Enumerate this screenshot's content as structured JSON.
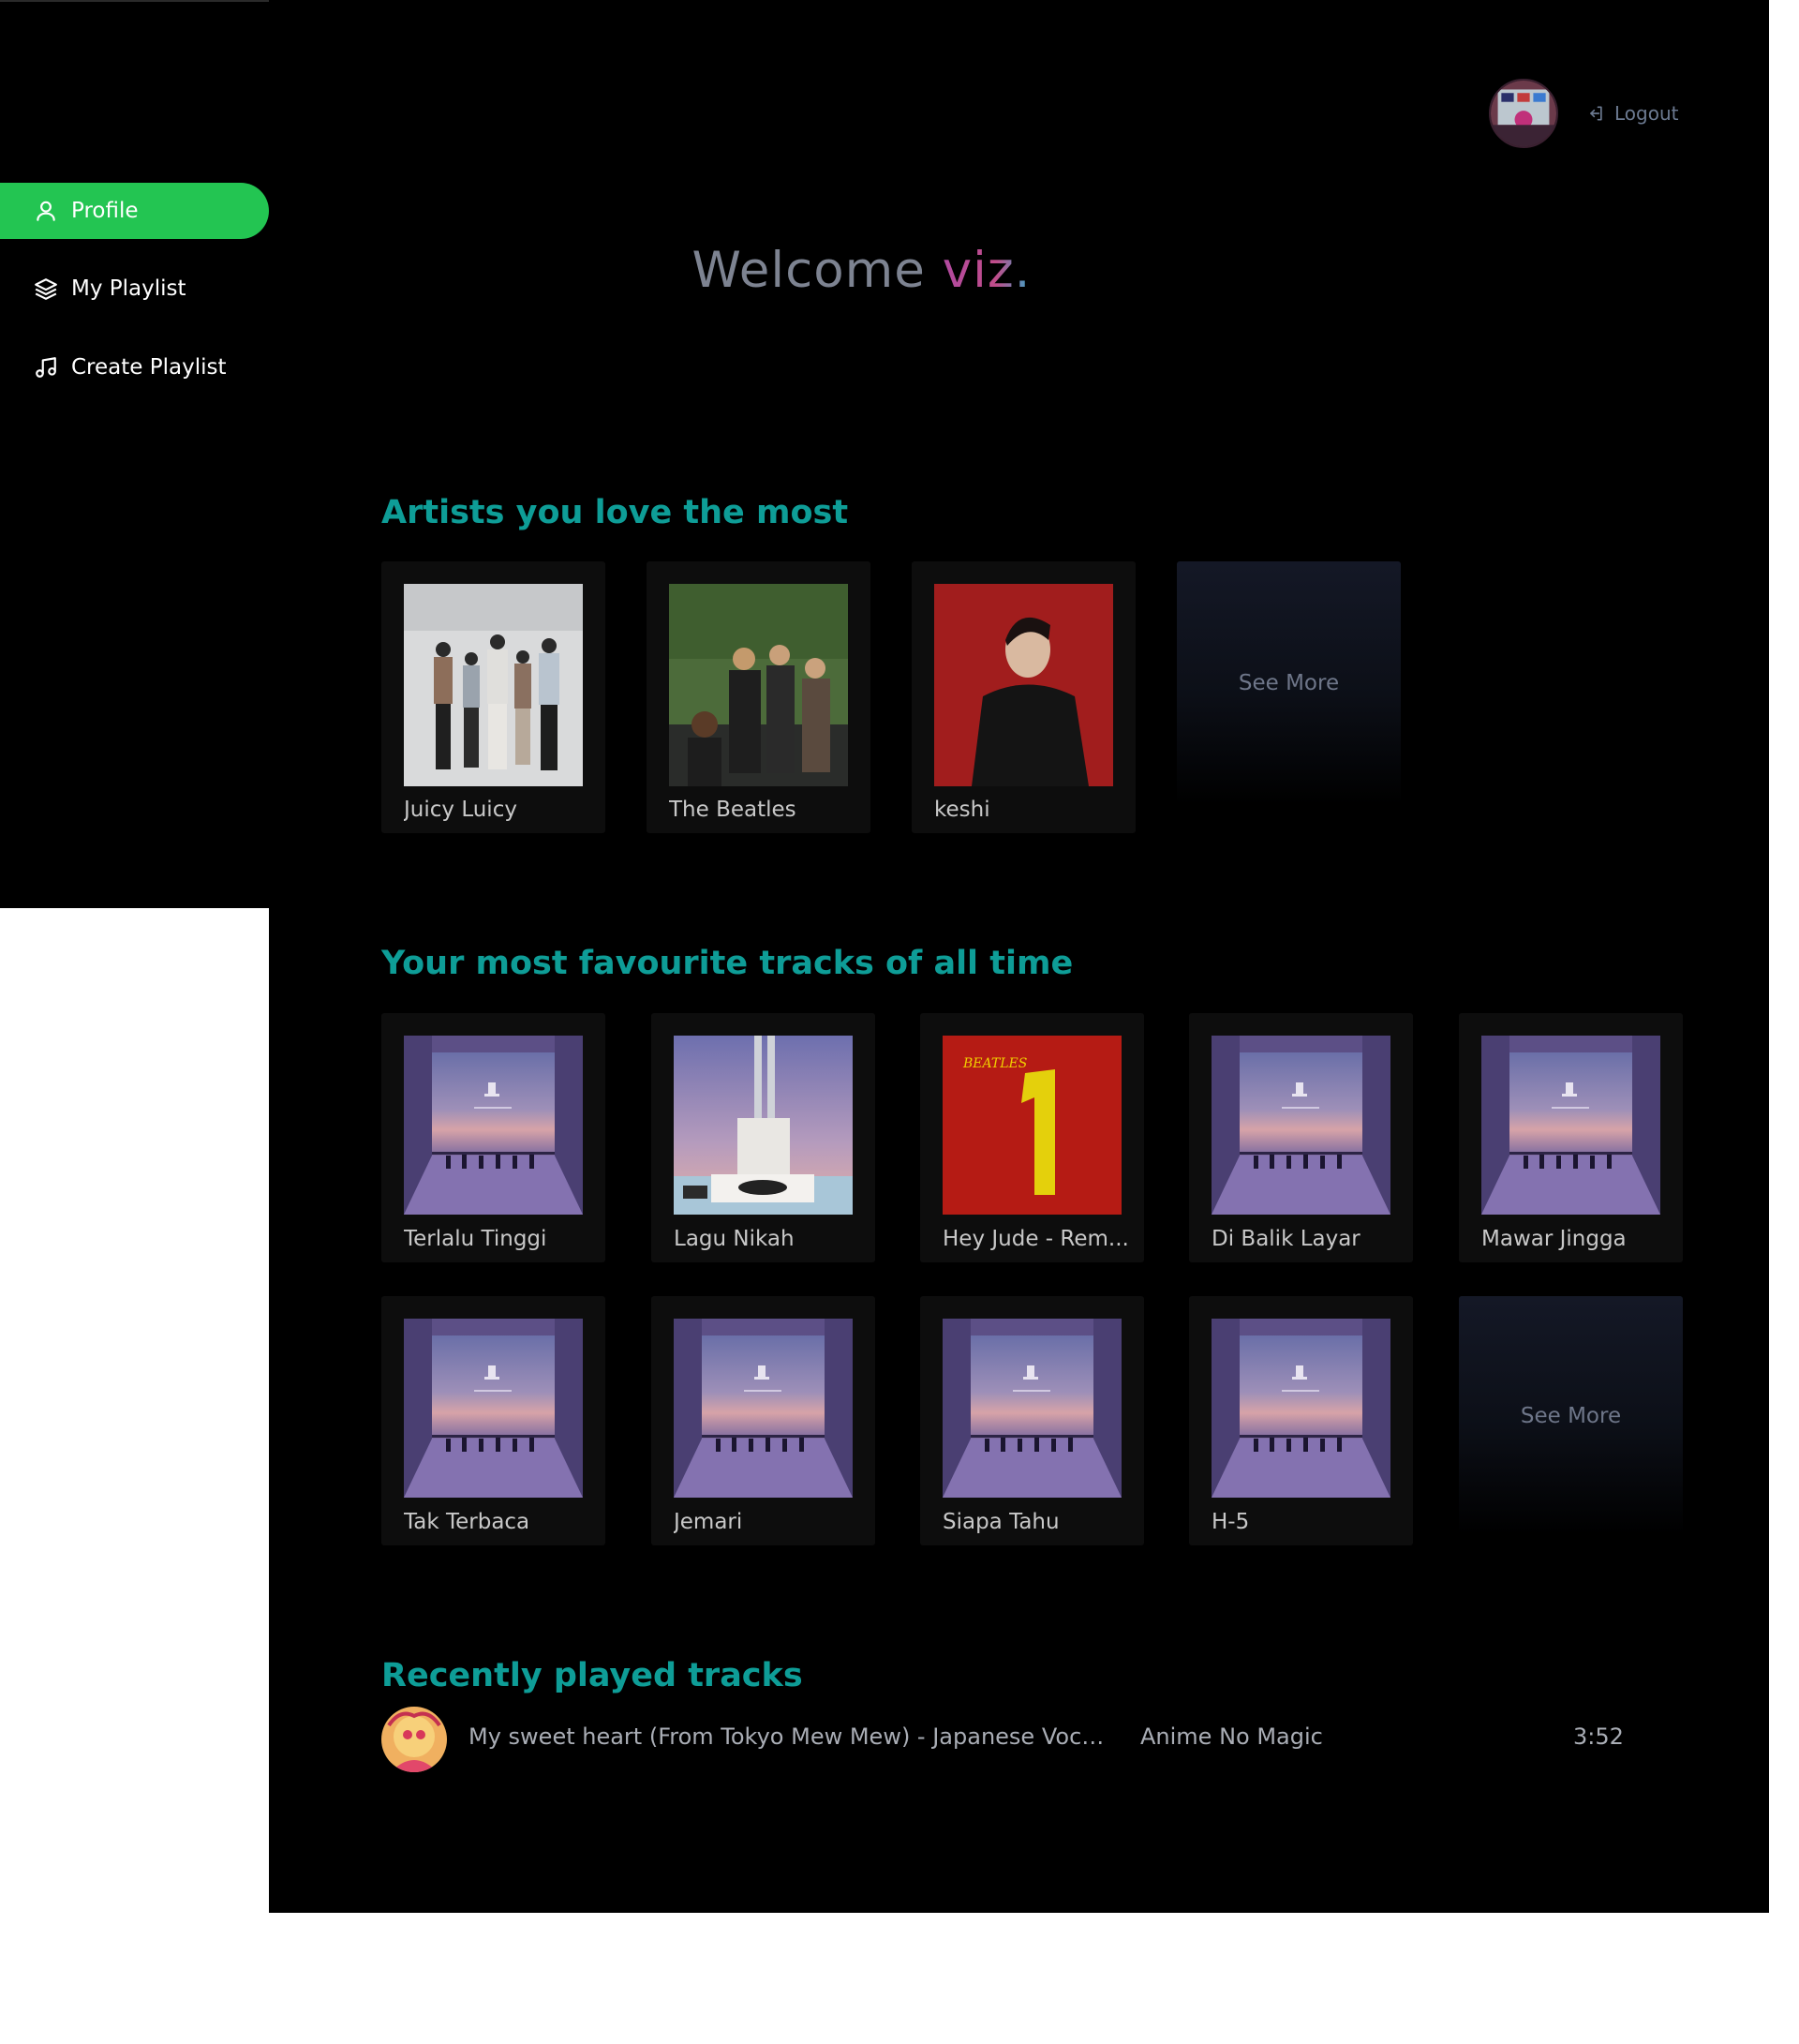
{
  "sidebar": {
    "items": [
      {
        "label": "Profile",
        "icon": "user-icon",
        "active": true
      },
      {
        "label": "My Playlist",
        "icon": "layers-icon",
        "active": false
      },
      {
        "label": "Create Playlist",
        "icon": "music-note-icon",
        "active": false
      }
    ]
  },
  "header": {
    "logout_label": "Logout",
    "logout_icon": "logout-icon"
  },
  "welcome": {
    "prefix": "Welcome",
    "username": "viz."
  },
  "artists": {
    "title": "Artists you love the most",
    "items": [
      {
        "name": "Juicy Luicy"
      },
      {
        "name": "The Beatles"
      },
      {
        "name": "keshi"
      }
    ],
    "see_more": "See More"
  },
  "tracks": {
    "title": "Your most favourite tracks of all time",
    "items": [
      {
        "name": "Terlalu Tinggi"
      },
      {
        "name": "Lagu Nikah"
      },
      {
        "name": "Hey Jude - Rem..."
      },
      {
        "name": "Di Balik Layar"
      },
      {
        "name": "Mawar Jingga"
      },
      {
        "name": "Tak Terbaca"
      },
      {
        "name": "Jemari"
      },
      {
        "name": "Siapa Tahu"
      },
      {
        "name": "H-5"
      }
    ],
    "see_more": "See More"
  },
  "recent": {
    "title": "Recently played tracks",
    "items": [
      {
        "title": "My sweet heart (From Tokyo Mew Mew) - Japanese Vocal V...",
        "artist": "Anime No Magic",
        "duration": "3:52"
      }
    ]
  },
  "colors": {
    "accent_green": "#23c552",
    "section_title": "#0e9d97",
    "welcome_gray": "#7d8391",
    "username_gradient": [
      "#b14aa0",
      "#3aa5c8"
    ]
  }
}
